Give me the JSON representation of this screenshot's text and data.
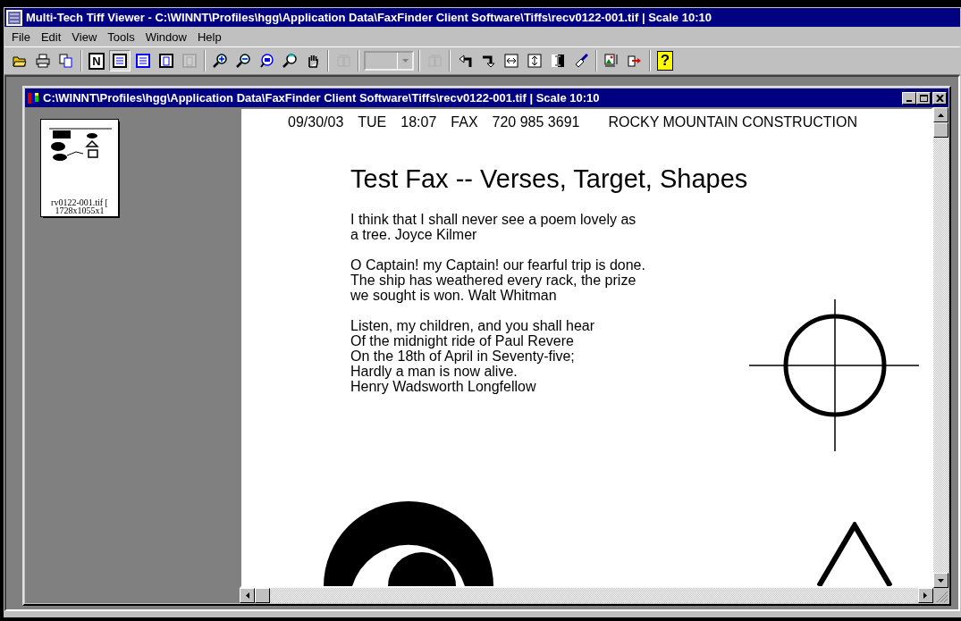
{
  "window": {
    "title": "Multi-Tech Tiff Viewer - C:\\WINNT\\Profiles\\hgg\\Application Data\\FaxFinder Client Software\\Tiffs\\recv0122-001.tif | Scale 10:10"
  },
  "menu": [
    "File",
    "Edit",
    "View",
    "Tools",
    "Window",
    "Help"
  ],
  "toolbar": [
    {
      "kind": "button",
      "pressed": false,
      "disabled": false
    },
    {
      "kind": "button",
      "pressed": false,
      "disabled": false
    },
    {
      "kind": "button",
      "pressed": false,
      "disabled": false
    },
    {
      "kind": "separator"
    },
    {
      "kind": "text",
      "label": "N",
      "pressed": false,
      "disabled": false
    },
    {
      "kind": "button",
      "pressed": true,
      "disabled": false
    },
    {
      "kind": "button",
      "pressed": false,
      "disabled": false
    },
    {
      "kind": "button",
      "pressed": false,
      "disabled": false
    },
    {
      "kind": "button",
      "pressed": false,
      "disabled": true
    },
    {
      "kind": "separator"
    },
    {
      "kind": "button",
      "pressed": false,
      "disabled": false
    },
    {
      "kind": "button",
      "pressed": false,
      "disabled": false
    },
    {
      "kind": "button",
      "pressed": false,
      "disabled": false
    },
    {
      "kind": "button",
      "pressed": false,
      "disabled": false
    },
    {
      "kind": "button",
      "pressed": false,
      "disabled": false
    },
    {
      "kind": "separator"
    },
    {
      "kind": "button",
      "pressed": false,
      "disabled": true
    },
    {
      "kind": "separator"
    },
    {
      "kind": "combo",
      "disabled": true
    },
    {
      "kind": "separator"
    },
    {
      "kind": "button",
      "pressed": false,
      "disabled": true
    },
    {
      "kind": "separator"
    },
    {
      "kind": "button",
      "pressed": false,
      "disabled": false
    },
    {
      "kind": "button",
      "pressed": false,
      "disabled": false
    },
    {
      "kind": "button",
      "pressed": false,
      "disabled": false
    },
    {
      "kind": "button",
      "pressed": false,
      "disabled": false
    },
    {
      "kind": "button",
      "pressed": false,
      "disabled": false
    },
    {
      "kind": "button",
      "pressed": false,
      "disabled": false
    },
    {
      "kind": "separator"
    },
    {
      "kind": "button",
      "pressed": false,
      "disabled": false
    },
    {
      "kind": "button",
      "pressed": false,
      "disabled": false
    },
    {
      "kind": "separator"
    },
    {
      "kind": "text",
      "label": "?",
      "pressed": false,
      "disabled": false
    }
  ],
  "document": {
    "title": "C:\\WINNT\\Profiles\\hgg\\Application Data\\FaxFinder Client Software\\Tiffs\\recv0122-001.tif | Scale 10:10",
    "thumbnails": [
      {
        "filename": "rv0122-001.tif [",
        "size": "1728x1055x1",
        "selected": true
      }
    ],
    "fax_header": [
      "09/30/03",
      "TUE",
      "18:07",
      "FAX",
      "720 985 3691",
      "ROCKY MOUNTAIN CONSTRUCTION"
    ],
    "fax_title": "Test Fax -- Verses, Target, Shapes",
    "verses": [
      [
        "I think that I shall never see a poem lovely as",
        "a tree. Joyce Kilmer"
      ],
      [
        "O Captain! my Captain! our fearful trip is done.",
        "The ship has weathered every rack, the prize",
        "we sought is won. Walt Whitman"
      ],
      [
        "Listen, my children, and you shall hear",
        "Of the midnight ride of Paul Revere",
        "On the 18th of April in Seventy-five;",
        "Hardly a man is now alive.",
        "Henry Wadsworth Longfellow"
      ]
    ]
  }
}
